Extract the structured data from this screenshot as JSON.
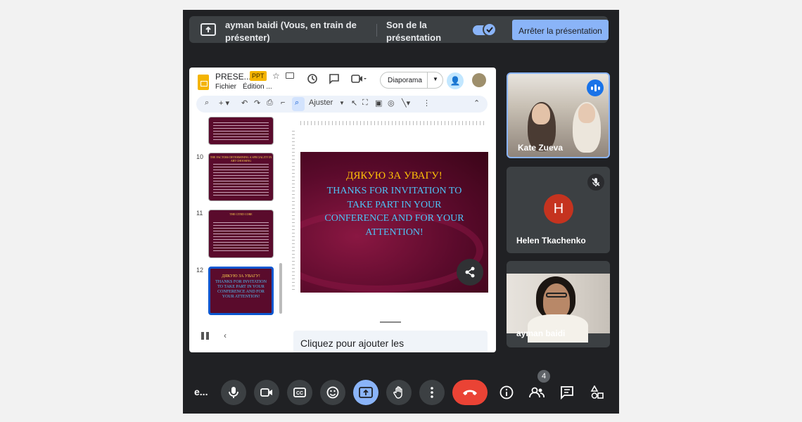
{
  "banner": {
    "presenter_text": "ayman baidi (Vous, en train de présenter)",
    "sound_label": "Son de la présentation",
    "sound_enabled": true,
    "stop_button_label": "Arrêter la présentation",
    "accent_color": "#8ab4f8"
  },
  "slides_app": {
    "doc_title": "PRESE...",
    "format_badge": "PPT",
    "menu": [
      "Fichier",
      "Édition ..."
    ],
    "slideshow_label": "Diaporama",
    "toolbar_fit_label": "Ajuster",
    "thumbnails": [
      {
        "number": "",
        "title": "",
        "selected": false
      },
      {
        "number": "10",
        "title": "THE FACTORS DETERMINING A SPECIALITY IN ART CHOOSING",
        "selected": false
      },
      {
        "number": "11",
        "title": "THE CITED CORE",
        "selected": false
      },
      {
        "number": "12",
        "title": "ДЯКУЮ ЗА УВАГУ!",
        "subtitle": "THANKS FOR INVITATION TO TAKE PART IN YOUR CONFERENCE AND FOR YOUR ATTENTION!",
        "selected": true
      }
    ],
    "current_slide": {
      "title": "ДЯКУЮ ЗА УВАГУ!",
      "body": "THANKS FOR INVITATION TO TAKE PART IN YOUR CONFERENCE AND FOR YOUR ATTENTION!",
      "title_color": "#ffc107",
      "body_color": "#4fc3f7",
      "background_color": "#6b0f36"
    },
    "notes_placeholder": "Cliquez pour ajouter les"
  },
  "participants": [
    {
      "name": "Kate Zueva",
      "speaking": true
    },
    {
      "name": "Helen Tkachenko",
      "initial": "H",
      "muted": true,
      "avatar_color": "#c5331f"
    },
    {
      "name": "ayman baidi"
    }
  ],
  "controls": {
    "meeting_name": "e...",
    "participants_count": "4",
    "end_call_color": "#ea4335",
    "present_active_color": "#8ab4f8"
  }
}
